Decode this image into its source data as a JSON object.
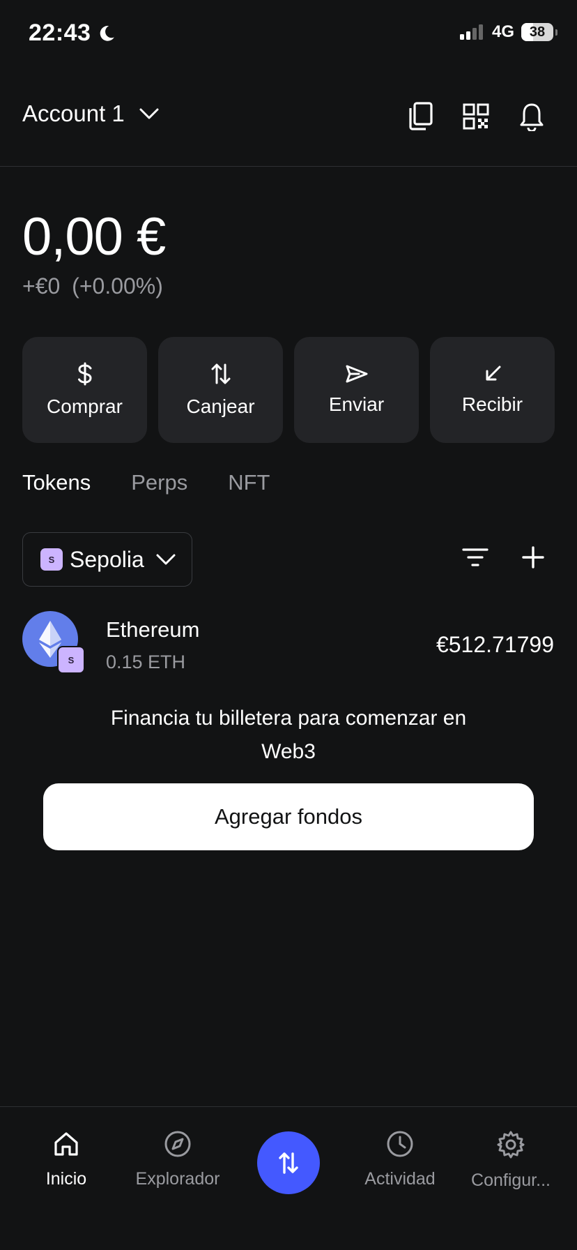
{
  "status_bar": {
    "time": "22:43",
    "network": "4G",
    "battery": "38",
    "battery_level": 0.38
  },
  "header": {
    "account_label": "Account 1"
  },
  "balance": {
    "total": "0,00 €",
    "change": "+€0",
    "change_pct": "(+0.00%)"
  },
  "actions": [
    {
      "label": "Comprar",
      "icon": "dollar-icon"
    },
    {
      "label": "Canjear",
      "icon": "swap-arrows-icon"
    },
    {
      "label": "Enviar",
      "icon": "send-icon"
    },
    {
      "label": "Recibir",
      "icon": "receive-arrow-icon"
    }
  ],
  "tabs": [
    {
      "label": "Tokens",
      "active": true
    },
    {
      "label": "Perps",
      "active": false
    },
    {
      "label": "NFT",
      "active": false
    }
  ],
  "network_selector": {
    "label": "Sepolia",
    "badge": "S"
  },
  "tokens": [
    {
      "name": "Ethereum",
      "amount": "0.15 ETH",
      "value": "€512.71799",
      "badge": "S",
      "logo_color": "#627eea"
    }
  ],
  "fund": {
    "message": "Financia tu billetera para comenzar en Web3",
    "button": "Agregar fondos"
  },
  "nav": {
    "items": [
      {
        "label": "Inicio",
        "icon": "home-icon",
        "active": true
      },
      {
        "label": "Explorador",
        "icon": "compass-icon",
        "active": false
      },
      {
        "label": "Actividad",
        "icon": "clock-icon",
        "active": false
      },
      {
        "label": "Configur...",
        "icon": "gear-icon",
        "active": false
      }
    ],
    "fab_icon": "swap-arrows-icon"
  },
  "colors": {
    "background": "#121314",
    "card": "#232427",
    "accent": "#4459ff",
    "muted_text": "#9a9ba0",
    "network_badge": "#ccb4ff"
  }
}
